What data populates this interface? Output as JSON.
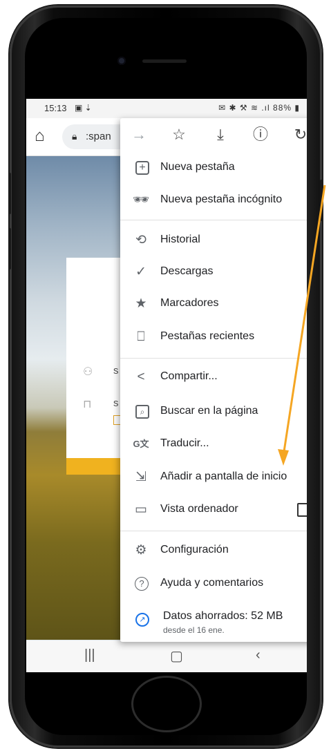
{
  "status_bar": {
    "time": "15:13",
    "left_icons": "▣ ⇣",
    "right_icons": "✉ ✱ ⚒ ≋ .ıl",
    "battery": "88%"
  },
  "address_bar": {
    "url_text": ":span"
  },
  "page": {
    "field_user_letter": "s",
    "field_pass_letter": "s"
  },
  "menu": {
    "top_icons": [
      "forward-icon",
      "star-icon",
      "download-icon",
      "info-icon",
      "reload-icon"
    ],
    "items": [
      {
        "label": "Nueva pestaña",
        "icon": "new-tab-icon"
      },
      {
        "label": "Nueva pestaña incógnito",
        "icon": "incognito-icon"
      },
      {
        "label": "Historial",
        "icon": "history-icon"
      },
      {
        "label": "Descargas",
        "icon": "downloads-icon"
      },
      {
        "label": "Marcadores",
        "icon": "bookmarks-star-icon"
      },
      {
        "label": "Pestañas recientes",
        "icon": "recent-tabs-icon"
      },
      {
        "label": "Compartir...",
        "icon": "share-icon"
      },
      {
        "label": "Buscar en la página",
        "icon": "find-in-page-icon"
      },
      {
        "label": "Traducir...",
        "icon": "translate-icon"
      },
      {
        "label": "Añadir a pantalla de inicio",
        "icon": "add-to-home-icon"
      },
      {
        "label": "Vista ordenador",
        "icon": "desktop-icon",
        "checked": false
      },
      {
        "label": "Configuración",
        "icon": "settings-gear-icon"
      },
      {
        "label": "Ayuda y comentarios",
        "icon": "help-icon"
      },
      {
        "label": "Datos ahorrados: 52 MB",
        "sub": "desde el 16 ene.",
        "icon": "data-saver-icon"
      }
    ]
  },
  "colors": {
    "accent_orange": "#f5a623",
    "data_saver_blue": "#1a73e8",
    "card_bar": "#f0b21f"
  }
}
